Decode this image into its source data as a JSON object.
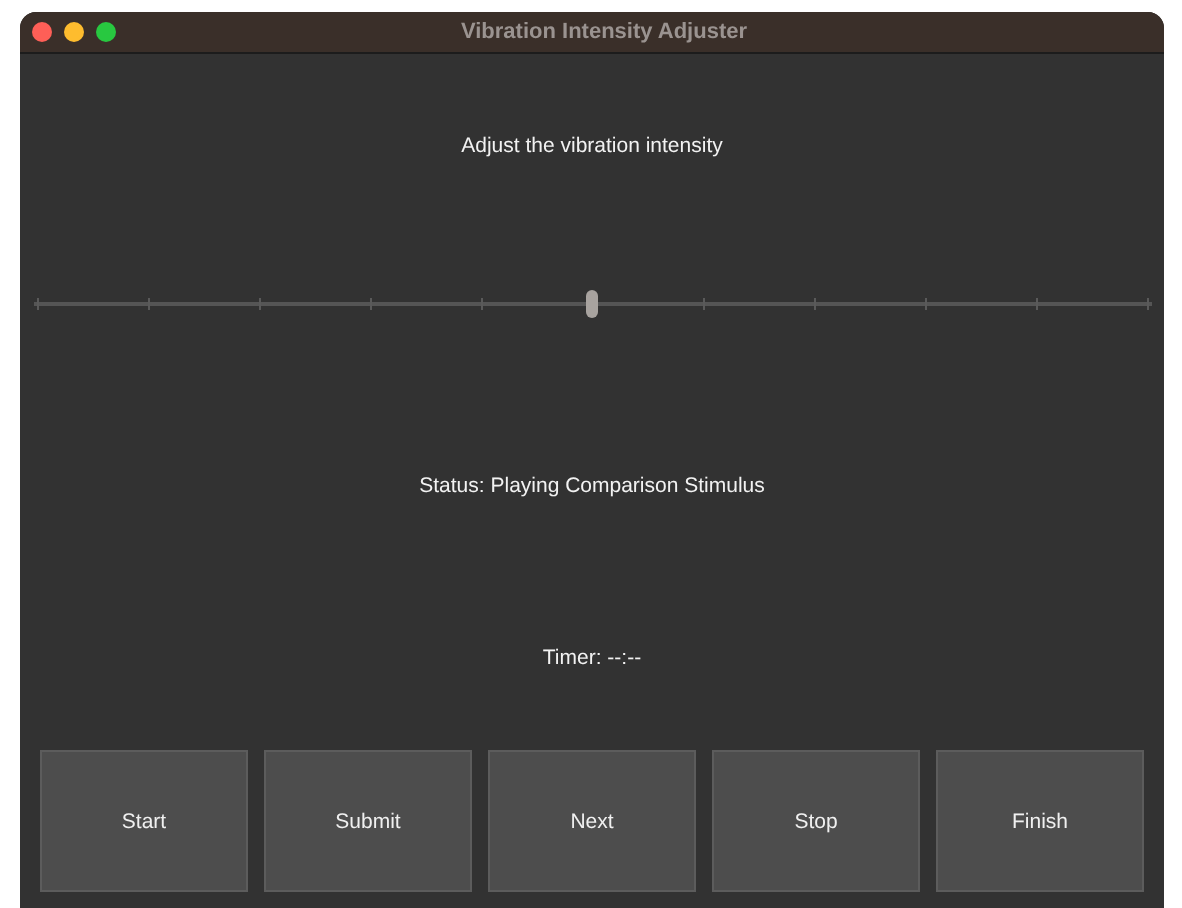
{
  "window": {
    "title": "Vibration Intensity Adjuster"
  },
  "prompt": "Adjust the vibration intensity",
  "slider": {
    "level": 0.5
  },
  "status": "Status: Playing Comparison Stimulus",
  "timer": "Timer: --:--",
  "buttons": [
    "Start",
    "Submit",
    "Next",
    "Stop",
    "Finish"
  ]
}
